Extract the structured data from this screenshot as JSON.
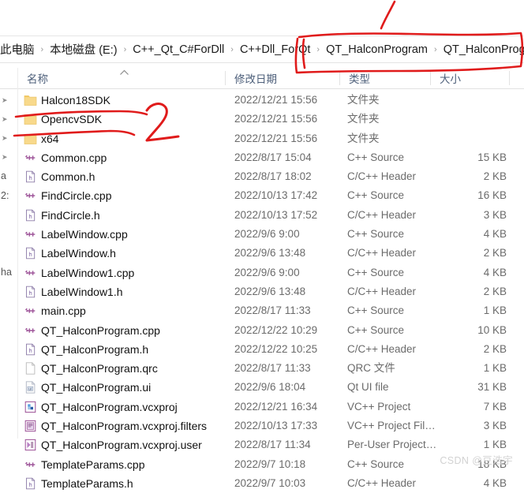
{
  "window": {
    "app": "windows-file-explorer"
  },
  "breadcrumb": {
    "name": "address-bar",
    "items": [
      {
        "label": "此电脑"
      },
      {
        "label": "本地磁盘 (E:)"
      },
      {
        "label": "C++_Qt_C#ForDll"
      },
      {
        "label": "C++Dll_ForQt"
      },
      {
        "label": "QT_HalconProgram"
      },
      {
        "label": "QT_HalconProgram"
      }
    ],
    "separator": "›"
  },
  "columns": {
    "name": "名称",
    "date": "修改日期",
    "type": "类型",
    "size": "大小",
    "sort_indicator": "︿"
  },
  "nav_fragments": [
    "a",
    "2:",
    "ha"
  ],
  "files": [
    {
      "name": "Halcon18SDK",
      "date": "2022/12/21 15:56",
      "type": "文件夹",
      "size": "",
      "icon": "folder-icon"
    },
    {
      "name": "OpencvSDK",
      "date": "2022/12/21 15:56",
      "type": "文件夹",
      "size": "",
      "icon": "folder-icon"
    },
    {
      "name": "x64",
      "date": "2022/12/21 15:56",
      "type": "文件夹",
      "size": "",
      "icon": "folder-icon"
    },
    {
      "name": "Common.cpp",
      "date": "2022/8/17 15:04",
      "type": "C++ Source",
      "size": "15 KB",
      "icon": "cpp-source-icon"
    },
    {
      "name": "Common.h",
      "date": "2022/8/17 18:02",
      "type": "C/C++ Header",
      "size": "2 KB",
      "icon": "header-file-icon"
    },
    {
      "name": "FindCircle.cpp",
      "date": "2022/10/13 17:42",
      "type": "C++ Source",
      "size": "16 KB",
      "icon": "cpp-source-icon"
    },
    {
      "name": "FindCircle.h",
      "date": "2022/10/13 17:52",
      "type": "C/C++ Header",
      "size": "3 KB",
      "icon": "header-file-icon"
    },
    {
      "name": "LabelWindow.cpp",
      "date": "2022/9/6 9:00",
      "type": "C++ Source",
      "size": "4 KB",
      "icon": "cpp-source-icon"
    },
    {
      "name": "LabelWindow.h",
      "date": "2022/9/6 13:48",
      "type": "C/C++ Header",
      "size": "2 KB",
      "icon": "header-file-icon"
    },
    {
      "name": "LabelWindow1.cpp",
      "date": "2022/9/6 9:00",
      "type": "C++ Source",
      "size": "4 KB",
      "icon": "cpp-source-icon"
    },
    {
      "name": "LabelWindow1.h",
      "date": "2022/9/6 13:48",
      "type": "C/C++ Header",
      "size": "2 KB",
      "icon": "header-file-icon"
    },
    {
      "name": "main.cpp",
      "date": "2022/8/17 11:33",
      "type": "C++ Source",
      "size": "1 KB",
      "icon": "cpp-source-icon"
    },
    {
      "name": "QT_HalconProgram.cpp",
      "date": "2022/12/22 10:29",
      "type": "C++ Source",
      "size": "10 KB",
      "icon": "cpp-source-icon"
    },
    {
      "name": "QT_HalconProgram.h",
      "date": "2022/12/22 10:25",
      "type": "C/C++ Header",
      "size": "2 KB",
      "icon": "header-file-icon"
    },
    {
      "name": "QT_HalconProgram.qrc",
      "date": "2022/8/17 11:33",
      "type": "QRC 文件",
      "size": "1 KB",
      "icon": "blank-document-icon"
    },
    {
      "name": "QT_HalconProgram.ui",
      "date": "2022/9/6 18:04",
      "type": "Qt UI file",
      "size": "31 KB",
      "icon": "qt-ui-icon"
    },
    {
      "name": "QT_HalconProgram.vcxproj",
      "date": "2022/12/21 16:34",
      "type": "VC++ Project",
      "size": "7 KB",
      "icon": "vcxproj-icon"
    },
    {
      "name": "QT_HalconProgram.vcxproj.filters",
      "date": "2022/10/13 17:33",
      "type": "VC++ Project Fil…",
      "size": "3 KB",
      "icon": "vcxproj-filters-icon"
    },
    {
      "name": "QT_HalconProgram.vcxproj.user",
      "date": "2022/8/17 11:34",
      "type": "Per-User Project…",
      "size": "1 KB",
      "icon": "vcxproj-user-icon"
    },
    {
      "name": "TemplateParams.cpp",
      "date": "2022/9/7 10:18",
      "type": "C++ Source",
      "size": "18 KB",
      "icon": "cpp-source-icon"
    },
    {
      "name": "TemplateParams.h",
      "date": "2022/9/7 10:03",
      "type": "C/C++ Header",
      "size": "4 KB",
      "icon": "header-file-icon"
    }
  ],
  "annotations": {
    "marker_number": "2",
    "color": "#e01b1b",
    "shapes": [
      "underline-halcon18sdk",
      "underline-opencvsdk-x64",
      "handwritten-2",
      "rect-around-last-breadcrumbs",
      "tick-above-breadcrumb"
    ]
  },
  "watermark": {
    "text": "CSDN @豆浩宇"
  },
  "colors": {
    "accent_annotation": "#e01b1b",
    "folder": "#f7d27e",
    "cpp_glyph": "#9b4f96",
    "header_text": "#4d5f7a",
    "meta_text": "#6b6b6b"
  }
}
